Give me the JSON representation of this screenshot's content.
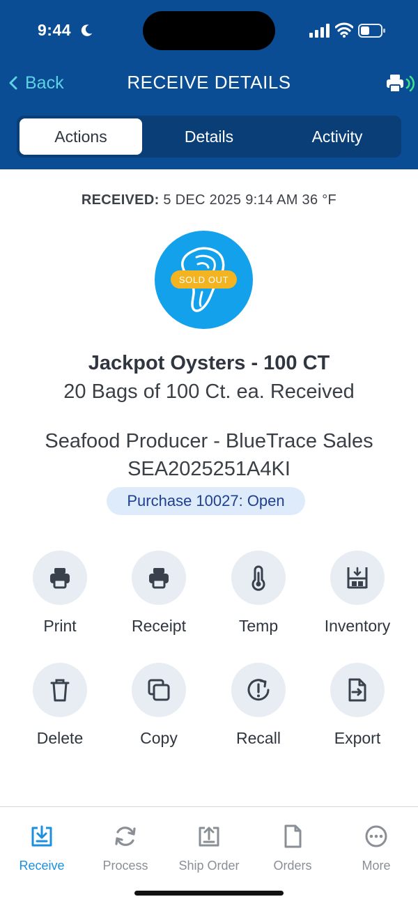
{
  "status_bar": {
    "time": "9:44"
  },
  "nav": {
    "back_label": "Back",
    "title": "RECEIVE DETAILS"
  },
  "segments": [
    {
      "label": "Actions",
      "active": true
    },
    {
      "label": "Details",
      "active": false
    },
    {
      "label": "Activity",
      "active": false
    }
  ],
  "received": {
    "prefix": "RECEIVED:",
    "value": "5 DEC 2025 9:14 AM 36 °F"
  },
  "product": {
    "badge": "SOLD OUT",
    "name": "Jackpot Oysters - 100 CT",
    "quantity": "20 Bags of 100 Ct. ea. Received",
    "producer": "Seafood Producer - BlueTrace Sales",
    "lot": "SEA2025251A4KI",
    "purchase": "Purchase 10027: Open"
  },
  "actions": [
    {
      "label": "Print",
      "icon": "printer-icon"
    },
    {
      "label": "Receipt",
      "icon": "receipt-printer-icon"
    },
    {
      "label": "Temp",
      "icon": "thermometer-icon"
    },
    {
      "label": "Inventory",
      "icon": "inventory-shelf-icon"
    },
    {
      "label": "Delete",
      "icon": "trash-icon"
    },
    {
      "label": "Copy",
      "icon": "copy-icon"
    },
    {
      "label": "Recall",
      "icon": "recall-icon"
    },
    {
      "label": "Export",
      "icon": "export-file-icon"
    }
  ],
  "tabs": [
    {
      "label": "Receive",
      "icon": "receive-tray-icon",
      "active": true
    },
    {
      "label": "Process",
      "icon": "process-cycle-icon",
      "active": false
    },
    {
      "label": "Ship Order",
      "icon": "ship-tray-icon",
      "active": false
    },
    {
      "label": "Orders",
      "icon": "document-icon",
      "active": false
    },
    {
      "label": "More",
      "icon": "more-dots-icon",
      "active": false
    }
  ],
  "colors": {
    "header": "#0b4d94",
    "accent_cyan": "#5dd2e4",
    "tab_active": "#1b8fe0",
    "badge": "#f4b321",
    "product_circle": "#12a1ea"
  }
}
